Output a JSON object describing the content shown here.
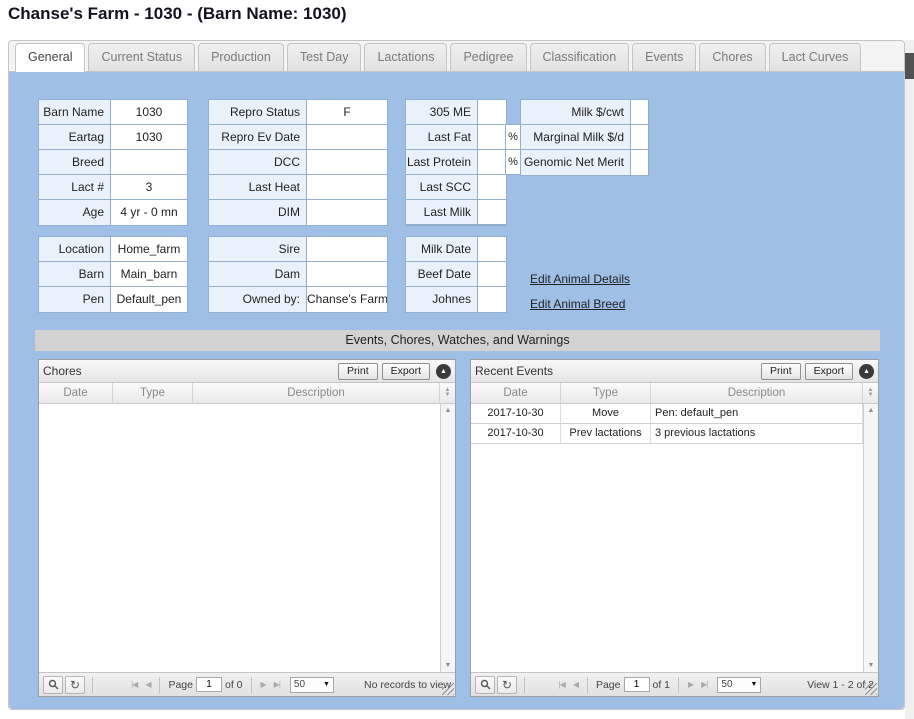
{
  "title": "Chanse's Farm - 1030 - (Barn Name: 1030)",
  "tabs": [
    {
      "label": "General"
    },
    {
      "label": "Current Status"
    },
    {
      "label": "Production"
    },
    {
      "label": "Test Day"
    },
    {
      "label": "Lactations"
    },
    {
      "label": "Pedigree"
    },
    {
      "label": "Classification"
    },
    {
      "label": "Events"
    },
    {
      "label": "Chores"
    },
    {
      "label": "Lact Curves"
    }
  ],
  "cards": {
    "identity": [
      {
        "label": "Barn Name",
        "value": "1030"
      },
      {
        "label": "Eartag",
        "value": "1030"
      },
      {
        "label": "Breed",
        "value": ""
      },
      {
        "label": "Lact #",
        "value": "3"
      },
      {
        "label": "Age",
        "value": "4 yr - 0 mn"
      }
    ],
    "repro": [
      {
        "label": "Repro Status",
        "value": "F"
      },
      {
        "label": "Repro Ev Date",
        "value": ""
      },
      {
        "label": "DCC",
        "value": ""
      },
      {
        "label": "Last Heat",
        "value": ""
      },
      {
        "label": "DIM",
        "value": ""
      }
    ],
    "milk": [
      {
        "label": "305 ME",
        "value": "",
        "suffix": ""
      },
      {
        "label": "Last Fat",
        "value": "",
        "suffix": "%"
      },
      {
        "label": "Last Protein",
        "value": "",
        "suffix": "%"
      },
      {
        "label": "Last SCC",
        "value": "",
        "suffix": ""
      },
      {
        "label": "Last Milk",
        "value": "",
        "suffix": ""
      }
    ],
    "economics": [
      {
        "label": "Milk $/cwt",
        "value": ""
      },
      {
        "label": "Marginal Milk $/d",
        "value": ""
      },
      {
        "label": "Genomic Net Merit",
        "value": ""
      }
    ],
    "location": [
      {
        "label": "Location",
        "value": "Home_farm"
      },
      {
        "label": "Barn",
        "value": "Main_barn"
      },
      {
        "label": "Pen",
        "value": "Default_pen"
      }
    ],
    "pedigree": [
      {
        "label": "Sire",
        "value": ""
      },
      {
        "label": "Dam",
        "value": ""
      },
      {
        "label": "Owned by:",
        "value": "Chanse's Farm"
      }
    ],
    "health": [
      {
        "label": "Milk Date",
        "value": ""
      },
      {
        "label": "Beef Date",
        "value": ""
      },
      {
        "label": "Johnes",
        "value": ""
      }
    ]
  },
  "links": {
    "edit_details": "Edit Animal Details",
    "edit_breed": "Edit Animal Breed"
  },
  "section_title": "Events, Chores, Watches, and Warnings",
  "chores": {
    "title": "Chores",
    "print": "Print",
    "export": "Export",
    "columns": {
      "date": "Date",
      "type": "Type",
      "description": "Description"
    },
    "pager": {
      "page_label": "Page",
      "page": "1",
      "of": "of 0",
      "size": "50",
      "status": "No records to view"
    }
  },
  "events": {
    "title": "Recent Events",
    "print": "Print",
    "export": "Export",
    "columns": {
      "date": "Date",
      "type": "Type",
      "description": "Description"
    },
    "rows": [
      {
        "date": "2017-10-30",
        "type": "Move",
        "description": "Pen: default_pen"
      },
      {
        "date": "2017-10-30",
        "type": "Prev lactations",
        "description": "3 previous lactations"
      }
    ],
    "pager": {
      "page_label": "Page",
      "page": "1",
      "of": "of 1",
      "size": "50",
      "status": "View 1 - 2 of 2"
    }
  },
  "icons": {
    "collapse": "▲",
    "refresh": "↻",
    "first": "|◀",
    "prev": "◀",
    "next": "▶",
    "last": "▶|",
    "dropdown": "▼",
    "sort_up": "▲",
    "sort_down": "▼",
    "scroll_up": "▲",
    "scroll_down": "▼"
  },
  "colors": {
    "content_bg": "#a0bfe7",
    "label_cell_bg": "#e9f1fa",
    "table_border": "#94afcc",
    "section_bar_bg": "#d2d2d2"
  }
}
